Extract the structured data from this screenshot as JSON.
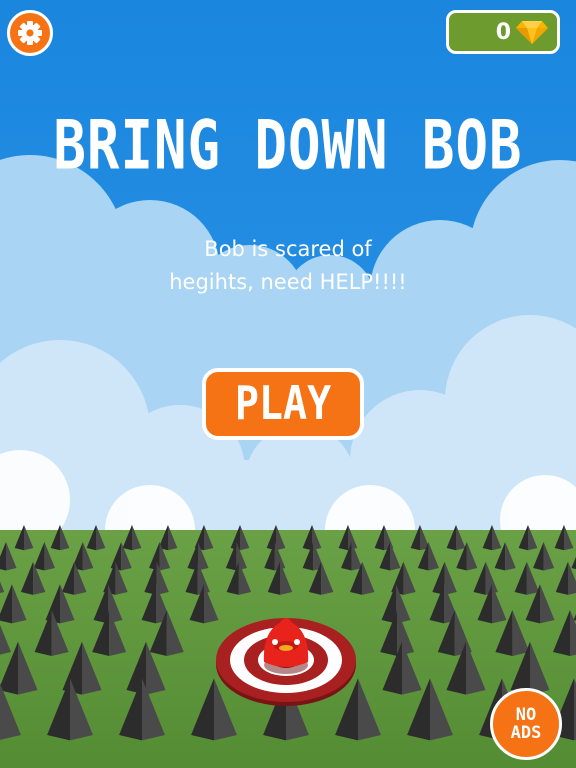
{
  "hud": {
    "gem_count": "0",
    "settings_icon": "gear-icon",
    "gem_icon": "gem-icon"
  },
  "title": "BRING DOWN BOB",
  "subtitle_lines": [
    "Bob  is scared of",
    "hegihts, need HELP!!!!"
  ],
  "play_label": "PLAY",
  "no_ads": {
    "line1": "NO",
    "line2": "ADS"
  },
  "colors": {
    "sky": "#1e8be0",
    "grass": "#5f9a3c",
    "accent": "#f57314",
    "coin_panel": "#6d9b2d",
    "gem": "#f7b500",
    "spike": "#3a3a3a",
    "target_red": "#9c1e1e",
    "bob": "#e8231c"
  }
}
